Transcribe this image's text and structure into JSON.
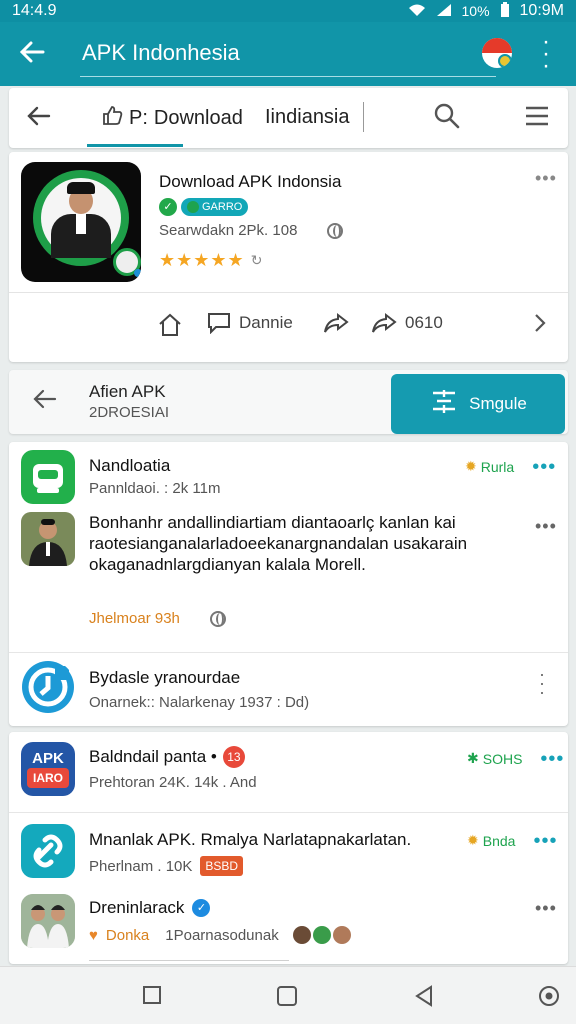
{
  "status_bar": {
    "left": "14:4.9",
    "signal_text": "10%",
    "time": "10:9M"
  },
  "app_bar": {
    "title": "APK Indonhesia"
  },
  "tab_bar": {
    "left_tab_prefix": "P:",
    "download_tab": "Download",
    "indonesia_tab": "Iindiansia"
  },
  "app_card": {
    "title": "Download APK Indonsia",
    "badge_text": "GARRO",
    "subtitle": "Searwdakn  2Pk. 108",
    "stars": "★★★★★",
    "actions": {
      "share_count_label": "Dannie",
      "forward_count_label": "0610"
    }
  },
  "filter_bar": {
    "title": "Afien APK",
    "subtitle": "2DROESIAI",
    "button_label": "Smgule"
  },
  "list1": {
    "item1": {
      "title": "Nandloatia",
      "subtitle": "Pannldaoi. : 2k 11m",
      "right_label": "Rurla"
    },
    "post": {
      "text": "Bonhanhr andallindiartiam diantaoarlç kanlan kai raotesianganalarladoeekanargnandalan usakarain okaganadnlargdianyan kalala Morell.",
      "author": "Jhelmoar 93h"
    },
    "item3": {
      "title": "Bydasle yranourdae",
      "subtitle": "Onarnek:: Nalarkenay 1937 : Dd)"
    }
  },
  "list2": {
    "item1": {
      "title": "Baldndail panta •",
      "badge": "13",
      "subtitle": "Prehtoran 24K. 14k . And",
      "right_label": "SOHS",
      "icon_text_top": "APK",
      "icon_text_bottom": "IARO"
    },
    "item2": {
      "title": "Mnanlak APK. Rmalya Narlatapnakarlatan.",
      "subtitle": "Pherlnam . 10K",
      "badge": "BSBD",
      "right_label": "Bnda"
    },
    "item3": {
      "title": "Dreninlarack",
      "left_label": "Donka",
      "subtitle": "1Poarnasodunak"
    }
  },
  "colors": {
    "primary": "#1195a8",
    "accent_orange": "#d9821e",
    "star": "#f5a623",
    "green": "#22a84a"
  }
}
